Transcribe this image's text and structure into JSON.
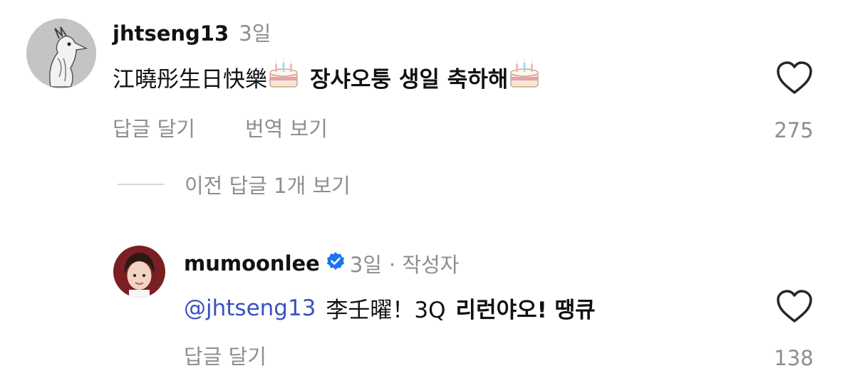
{
  "comments": [
    {
      "username": "jhtseng13",
      "time": "3일",
      "text_cjk": "江曉彤生日快樂",
      "text_ko": "장샤오퉁 생일 축하해",
      "emoji_icon": "birthday-cake-icon",
      "reply_label": "답글 달기",
      "translate_label": "번역 보기",
      "like_count": "275"
    },
    {
      "username": "mumoonlee",
      "time": "3일",
      "author_label": "· 작성자",
      "verified_icon": "verified-badge-icon",
      "mention": "@jhtseng13",
      "text_main": "李壬曜！3Q",
      "text_ko": "리런야오! 땡큐",
      "reply_label": "답글 달기",
      "like_count": "138"
    }
  ],
  "view_previous_replies": "이전 답글 1개 보기",
  "colors": {
    "text": "#111111",
    "muted": "#8e8e8e",
    "mention": "#3a51c2",
    "verified": "#1877f2",
    "divider": "#d6d6d6"
  }
}
